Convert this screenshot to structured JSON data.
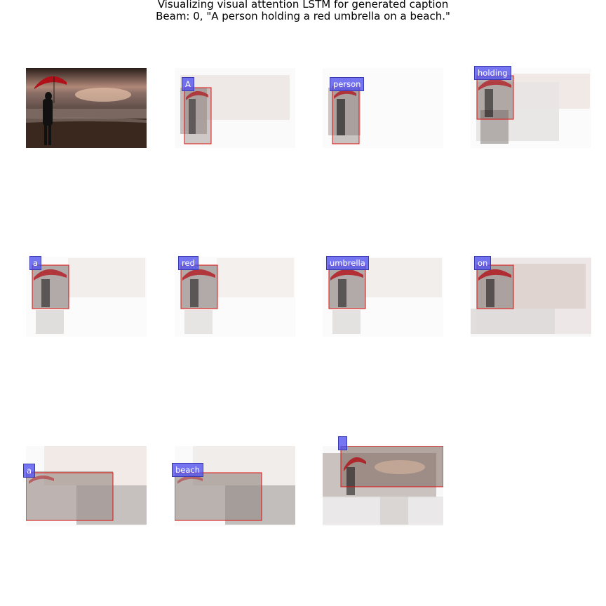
{
  "figure": {
    "title_line1": "Visualizing visual attention LSTM for generated caption",
    "title_line2": "Beam: 0, \"A person holding a red umbrella on a beach.\""
  },
  "panels": [
    {
      "word": ""
    },
    {
      "word": "A"
    },
    {
      "word": "person"
    },
    {
      "word": "holding"
    },
    {
      "word": "a"
    },
    {
      "word": "red"
    },
    {
      "word": "umbrella"
    },
    {
      "word": "on"
    },
    {
      "word": "a"
    },
    {
      "word": "beach"
    },
    {
      "word": ""
    }
  ],
  "colors": {
    "sky_top": "#3a2a22",
    "sky_glow": "#c9a088",
    "sea": "#6b5a52",
    "sand": "#3e2a20",
    "umbrella": "#b01018",
    "box_edge": "#e01010",
    "label_bg": "#5050f0"
  }
}
